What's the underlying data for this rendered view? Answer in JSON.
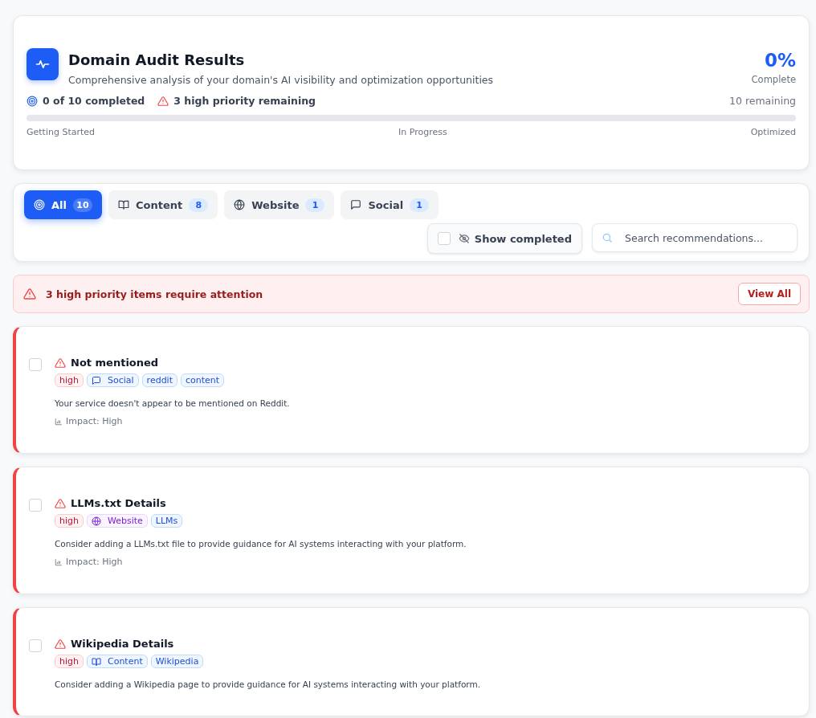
{
  "header": {
    "title": "Domain Audit Results",
    "subtitle": "Comprehensive analysis of your domain's AI visibility and optimization opportunities",
    "percent": "0%",
    "percent_label": "Complete",
    "completed": "0 of 10 completed",
    "high_remaining": "3 high priority remaining",
    "remaining": "10 remaining",
    "progress": {
      "level": 0
    },
    "stages": [
      "Getting Started",
      "In Progress",
      "Optimized"
    ]
  },
  "tabs": [
    {
      "kind": "all",
      "label": "All",
      "count": "10",
      "selected": true
    },
    {
      "kind": "content",
      "label": "Content",
      "count": "8",
      "selected": false
    },
    {
      "kind": "website",
      "label": "Website",
      "count": "1",
      "selected": false
    },
    {
      "kind": "social",
      "label": "Social",
      "count": "1",
      "selected": false
    }
  ],
  "show_completed": {
    "label": "Show completed",
    "checked": false
  },
  "search": {
    "placeholder": "Search recommendations..."
  },
  "alert": {
    "text": "3 high priority items require attention",
    "button": "View All"
  },
  "recommendations": [
    {
      "title": "Not mentioned",
      "checked": false,
      "priority": "high",
      "category": {
        "kind": "social",
        "label": "Social"
      },
      "tags": [
        "reddit",
        "content"
      ],
      "description": "Your service doesn't appear to be mentioned on Reddit.",
      "impact": "Impact: High"
    },
    {
      "title": "LLMs.txt Details",
      "checked": false,
      "priority": "high",
      "category": {
        "kind": "website",
        "label": "Website"
      },
      "tags": [
        "LLMs"
      ],
      "description": "Consider adding a LLMs.txt file to provide guidance for AI systems interacting with your platform.",
      "impact": "Impact: High"
    },
    {
      "title": "Wikipedia Details",
      "checked": false,
      "priority": "high",
      "category": {
        "kind": "content",
        "label": "Content"
      },
      "tags": [
        "Wikipedia"
      ],
      "description": "Consider adding a Wikipedia page to provide guidance for AI systems interacting with your platform."
    }
  ]
}
